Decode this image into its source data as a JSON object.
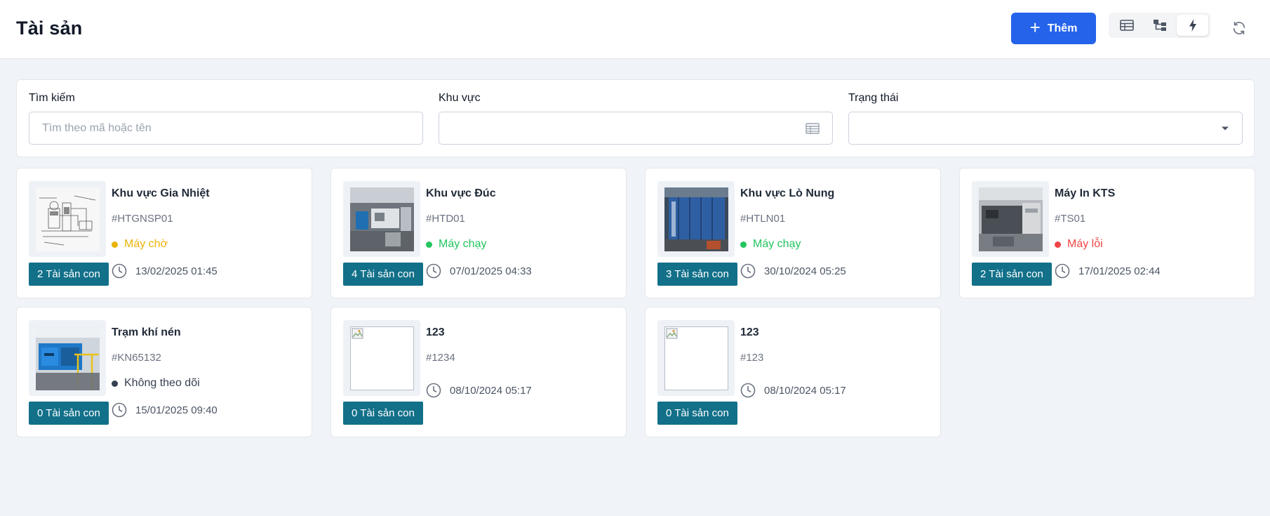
{
  "header": {
    "title": "Tài sản",
    "add_label": "Thêm",
    "accent_color": "#2563eb"
  },
  "view_modes": [
    {
      "icon": "table-view-icon",
      "active": false
    },
    {
      "icon": "tree-view-icon",
      "active": false
    },
    {
      "icon": "lightning-view-icon",
      "active": true
    }
  ],
  "filters": {
    "search_label": "Tìm kiếm",
    "search_placeholder": "Tìm theo mã hoặc tên",
    "search_value": "",
    "area_label": "Khu vực",
    "area_value": "",
    "status_label": "Trạng thái",
    "status_value": ""
  },
  "status_colors": {
    "waiting": "#eab308",
    "running": "#22c55e",
    "error": "#ef4444",
    "untracked": "#374151"
  },
  "assets": [
    {
      "name": "Khu vực Gia Nhiệt",
      "code": "#HTGNSP01",
      "status": "Máy chờ",
      "status_key": "waiting",
      "time": "13/02/2025 01:45",
      "children": "2 Tài sản con",
      "image": "diagram"
    },
    {
      "name": "Khu vực Đúc",
      "code": "#HTD01",
      "status": "Máy chạy",
      "status_key": "running",
      "time": "07/01/2025 04:33",
      "children": "4 Tài sản con",
      "image": "factory"
    },
    {
      "name": "Khu vực Lò Nung",
      "code": "#HTLN01",
      "status": "Máy chạy",
      "status_key": "running",
      "time": "30/10/2024 05:25",
      "children": "3 Tài sản con",
      "image": "furnace"
    },
    {
      "name": "Máy In KTS",
      "code": "#TS01",
      "status": "Máy lỗi",
      "status_key": "error",
      "time": "17/01/2025 02:44",
      "children": "2 Tài sản con",
      "image": "printer"
    },
    {
      "name": "Trạm khí nén",
      "code": "#KN65132",
      "status": "Không theo dõi",
      "status_key": "untracked",
      "time": "15/01/2025 09:40",
      "children": "0 Tài sản con",
      "image": "compressor"
    },
    {
      "name": "123",
      "code": "#1234",
      "status": "",
      "status_key": "",
      "time": "08/10/2024 05:17",
      "children": "0 Tài sản con",
      "image": "broken"
    },
    {
      "name": "123",
      "code": "#123",
      "status": "",
      "status_key": "",
      "time": "08/10/2024 05:17",
      "children": "0 Tài sản con",
      "image": "broken"
    }
  ]
}
